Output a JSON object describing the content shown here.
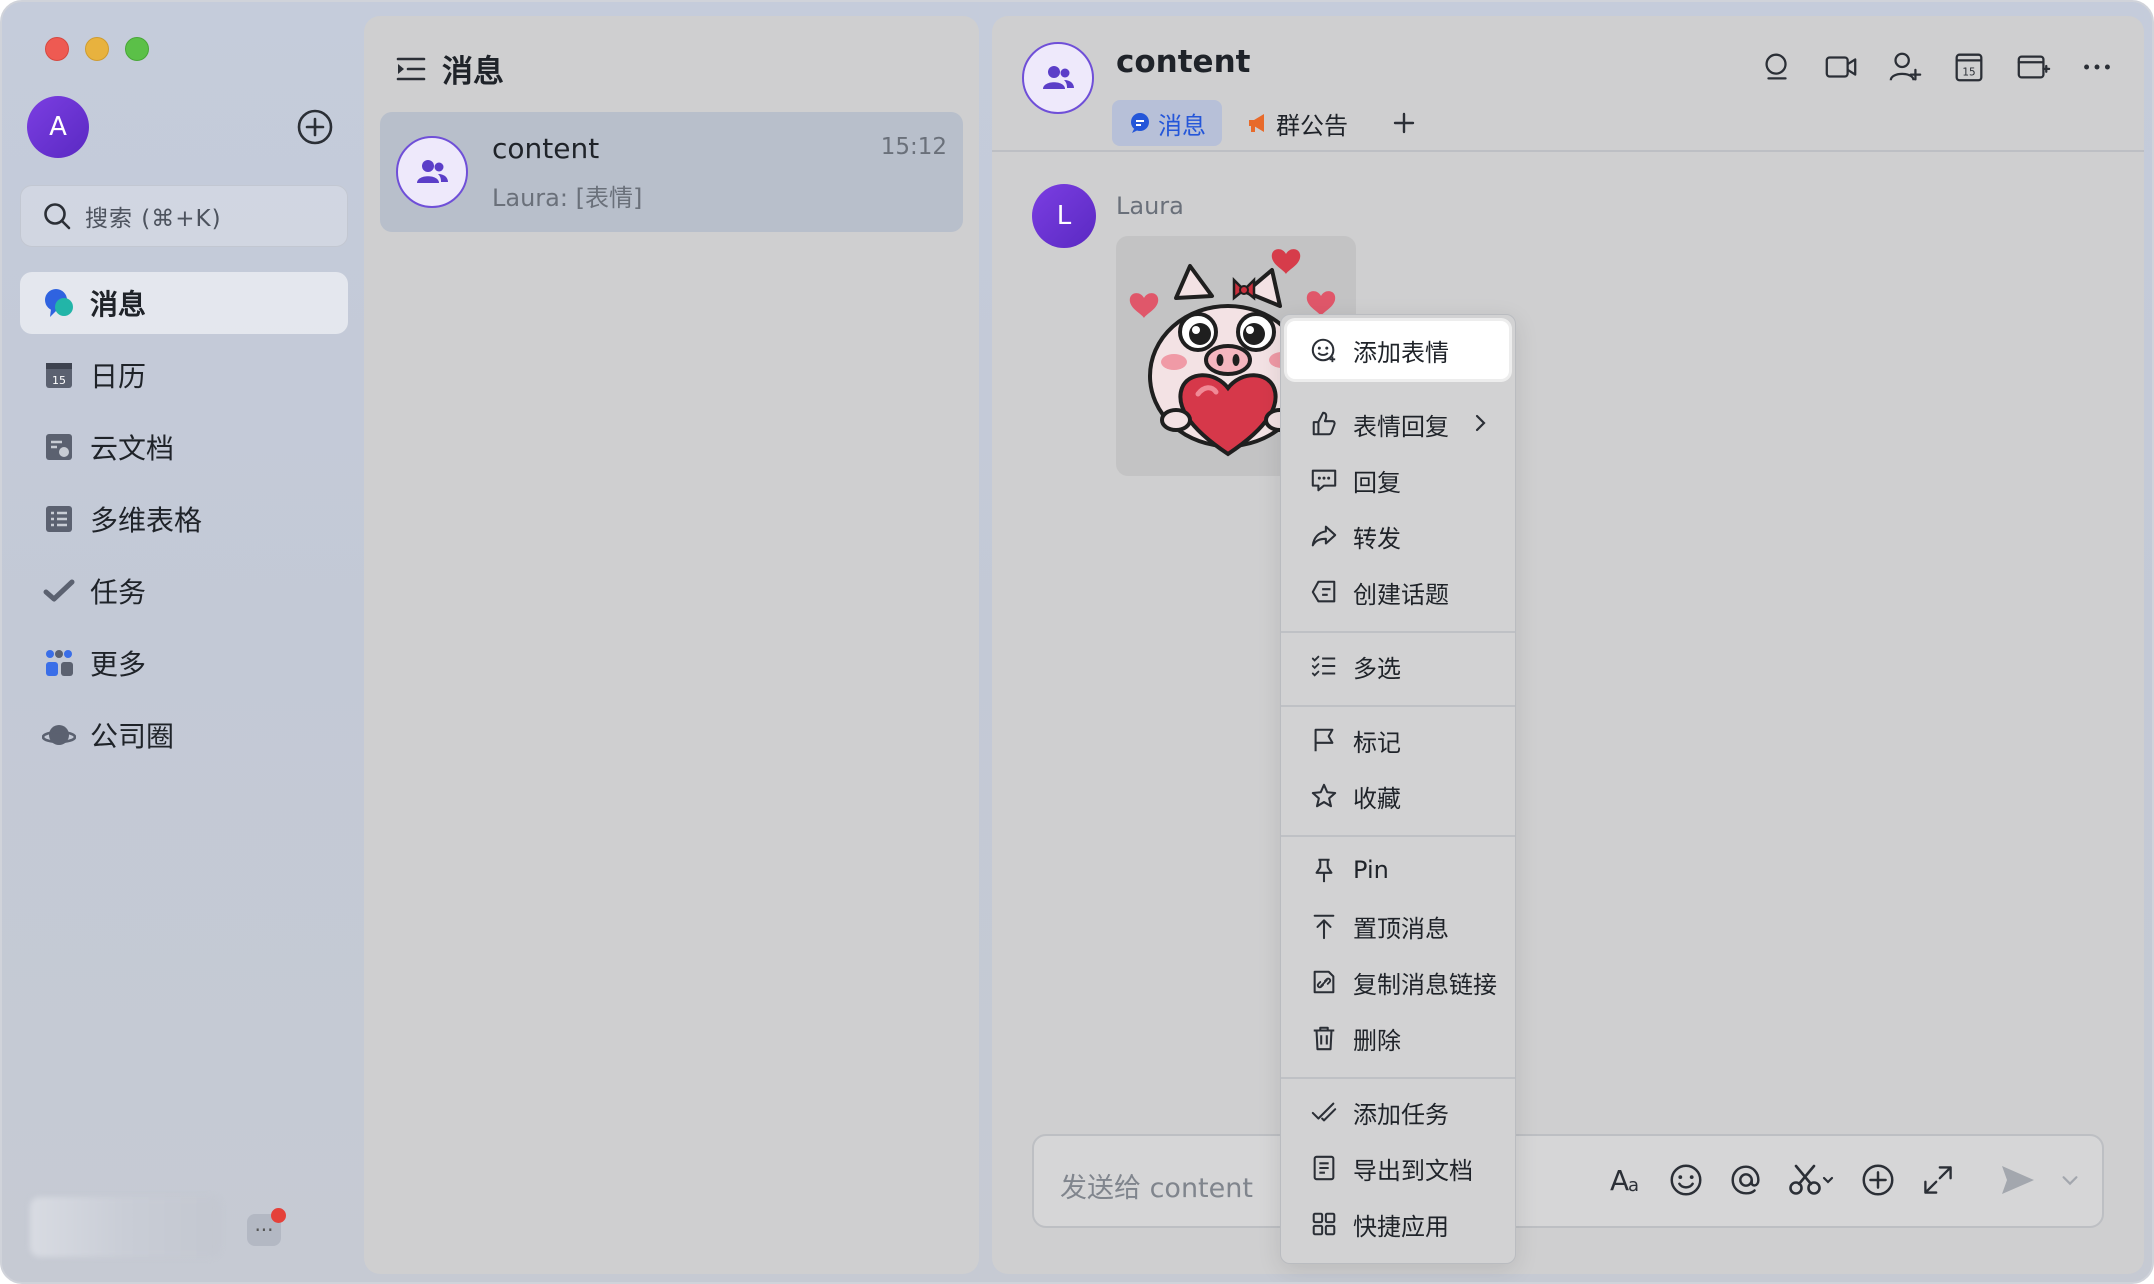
{
  "nav": {
    "avatar_initial": "A",
    "search_placeholder": "搜索 (⌘+K)",
    "items": [
      {
        "label": "消息",
        "icon": "message-bubble-icon",
        "active": true
      },
      {
        "label": "日历",
        "icon": "calendar-icon"
      },
      {
        "label": "云文档",
        "icon": "cloud-doc-icon"
      },
      {
        "label": "多维表格",
        "icon": "table-icon"
      },
      {
        "label": "任务",
        "icon": "task-check-icon"
      },
      {
        "label": "更多",
        "icon": "more-apps-icon"
      },
      {
        "label": "公司圈",
        "icon": "planet-icon"
      }
    ],
    "more_badge": "···"
  },
  "list": {
    "title": "消息",
    "chats": [
      {
        "name": "content",
        "preview": "Laura: [表情]",
        "time": "15:12"
      }
    ]
  },
  "chat": {
    "title": "content",
    "tabs": [
      {
        "label": "消息",
        "icon": "chat-bubble-icon",
        "active": true
      },
      {
        "label": "群公告",
        "icon": "megaphone-icon"
      }
    ],
    "header_icons": [
      "search-chat-icon",
      "video-call-icon",
      "add-member-icon",
      "calendar-icon",
      "new-topic-icon",
      "more-icon"
    ],
    "message": {
      "sender_initial": "L",
      "sender": "Laura"
    },
    "input_placeholder": "发送给 content",
    "input_tools": [
      "font-format-icon",
      "emoji-icon",
      "mention-icon",
      "scissors-icon",
      "plus-circle-icon",
      "expand-icon",
      "send-icon",
      "chevron-down-icon"
    ]
  },
  "context_menu": {
    "items": [
      {
        "label": "添加表情",
        "icon": "add-sticker-icon",
        "highlighted": true
      },
      {
        "label": "表情回复",
        "icon": "thumbs-up-icon",
        "submenu": true
      },
      {
        "label": "回复",
        "icon": "reply-icon"
      },
      {
        "label": "转发",
        "icon": "forward-icon"
      },
      {
        "label": "创建话题",
        "icon": "create-topic-icon"
      },
      {
        "label": "多选",
        "icon": "multi-select-icon"
      },
      {
        "label": "标记",
        "icon": "flag-icon"
      },
      {
        "label": "收藏",
        "icon": "star-icon"
      },
      {
        "label": "Pin",
        "icon": "pin-icon"
      },
      {
        "label": "置顶消息",
        "icon": "pin-to-top-icon"
      },
      {
        "label": "复制消息链接",
        "icon": "copy-link-icon"
      },
      {
        "label": "删除",
        "icon": "trash-icon"
      },
      {
        "label": "添加任务",
        "icon": "add-task-icon"
      },
      {
        "label": "导出到文档",
        "icon": "export-doc-icon"
      },
      {
        "label": "快捷应用",
        "icon": "quick-apps-icon"
      }
    ]
  },
  "colors": {
    "accent_purple": "#6f4fd8",
    "tab_active_blue": "#2456d9",
    "notification_red": "#e5413a"
  }
}
